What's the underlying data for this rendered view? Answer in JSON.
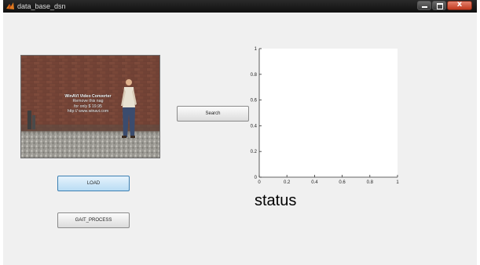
{
  "window": {
    "title": "data_base_dsn",
    "controls": [
      "minimize-icon",
      "maximize-icon",
      "close-icon"
    ]
  },
  "video": {
    "overlay_title": "WinAVI Video Converter",
    "overlay_line1": "Remove this nag",
    "overlay_line2": "for only $ 19.95",
    "overlay_line3": "http:// www.winavi.com"
  },
  "buttons": {
    "search": "Search",
    "load": "LOAD",
    "gait_process": "GAIT_PROCESS"
  },
  "plot": {
    "xticks": [
      "0",
      "0.2",
      "0.4",
      "0.6",
      "0.8",
      "1"
    ],
    "yticks": [
      "0",
      "0.2",
      "0.4",
      "0.6",
      "0.8",
      "1"
    ],
    "xlim": [
      0,
      1
    ],
    "ylim": [
      0,
      1
    ]
  },
  "status": "status",
  "colors": {
    "titlebar": "#151515",
    "background": "#f0f0f0",
    "load_button": "#c6e3f7",
    "close_button": "#c7432a"
  }
}
